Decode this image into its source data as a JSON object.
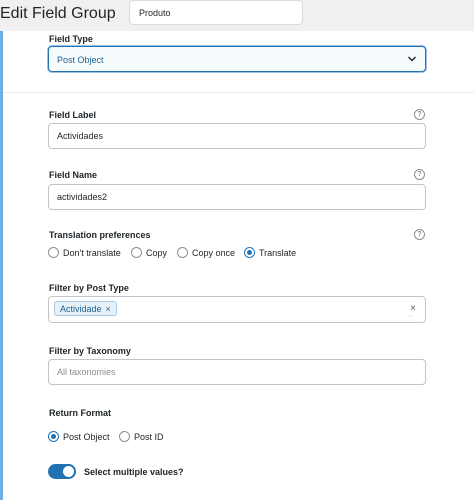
{
  "header": {
    "title": "Edit Field Group",
    "group_name": "Produto"
  },
  "field_type": {
    "label": "Field Type",
    "value": "Post Object"
  },
  "field_label": {
    "label": "Field Label",
    "value": "Actividades"
  },
  "field_name": {
    "label": "Field Name",
    "value": "actividades2"
  },
  "translation": {
    "label": "Translation preferences",
    "options": [
      "Don't translate",
      "Copy",
      "Copy once",
      "Translate"
    ],
    "selected": "Translate"
  },
  "filter_post_type": {
    "label": "Filter by Post Type",
    "tags": [
      "Actividade"
    ],
    "clear_glyph": "×"
  },
  "filter_taxonomy": {
    "label": "Filter by Taxonomy",
    "placeholder": "All taxonomies"
  },
  "return_format": {
    "label": "Return Format",
    "options": [
      "Post Object",
      "Post ID"
    ],
    "selected": "Post Object"
  },
  "multiple": {
    "label": "Select multiple values?",
    "enabled": true
  },
  "help_glyph": "?",
  "colors": {
    "accent": "#2271b1",
    "sidebar_accent": "#72aee6"
  }
}
